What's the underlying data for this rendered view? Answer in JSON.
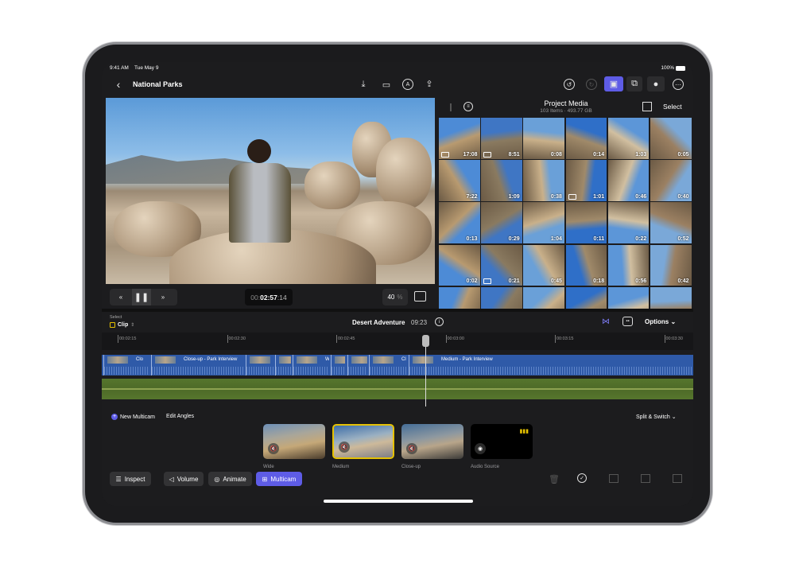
{
  "status": {
    "time": "9:41 AM",
    "date": "Tue May 9",
    "battery": "100%"
  },
  "toolbar": {
    "back_icon": "chevron-left-icon",
    "title": "National Parks",
    "icons": [
      "import-icon",
      "camera-icon",
      "voiceover-icon",
      "share-icon"
    ],
    "right_icons": [
      "undo-icon",
      "redo-icon",
      "photos-icon",
      "effects-icon",
      "microphone-icon",
      "more-icon"
    ]
  },
  "viewer": {
    "timecode_dim": "00:",
    "timecode": "02:57",
    "frames": ":14",
    "zoom": "40",
    "zoom_unit": "%"
  },
  "media": {
    "title": "Project Media",
    "subtitle": "103 Items  ·  493.77 GB",
    "select": "Select",
    "durations": [
      "17:08",
      "8:51",
      "0:08",
      "0:14",
      "1:03",
      "0:05",
      "7:22",
      "1:09",
      "0:38",
      "1:01",
      "0:46",
      "0:40",
      "0:13",
      "0:29",
      "1:04",
      "0:11",
      "0:22",
      "0:52",
      "0:02",
      "0:21",
      "0:45",
      "0:18",
      "0:56",
      "0:42",
      "",
      "",
      "",
      "",
      "",
      ""
    ],
    "multicam_cells": [
      0,
      1,
      9,
      19,
      25
    ]
  },
  "timeline": {
    "select_label": "Select",
    "select_value": "Clip",
    "project": "Desert Adventure",
    "duration": "09:23",
    "options": "Options",
    "ruler": [
      "00:02:15",
      "00:02:30",
      "00:02:45",
      "00:03:00",
      "00:03:15",
      "00:03:30"
    ],
    "clips": [
      "Clo",
      "Close-up - Park Interview",
      "",
      "",
      "W",
      "",
      "",
      "Cl",
      "Medium - Park Interview"
    ]
  },
  "multicam": {
    "new": "New Multicam",
    "edit": "Edit Angles",
    "mode": "Split & Switch",
    "angles": [
      "Wide",
      "Medium",
      "Close-up",
      "Audio Source"
    ],
    "selected_angle": "Medium",
    "accent": "#e5c100"
  },
  "bottom": {
    "inspect": "Inspect",
    "volume": "Volume",
    "animate": "Animate",
    "multicam": "Multicam",
    "active": "Multicam",
    "accent": "#5e5ce6"
  }
}
